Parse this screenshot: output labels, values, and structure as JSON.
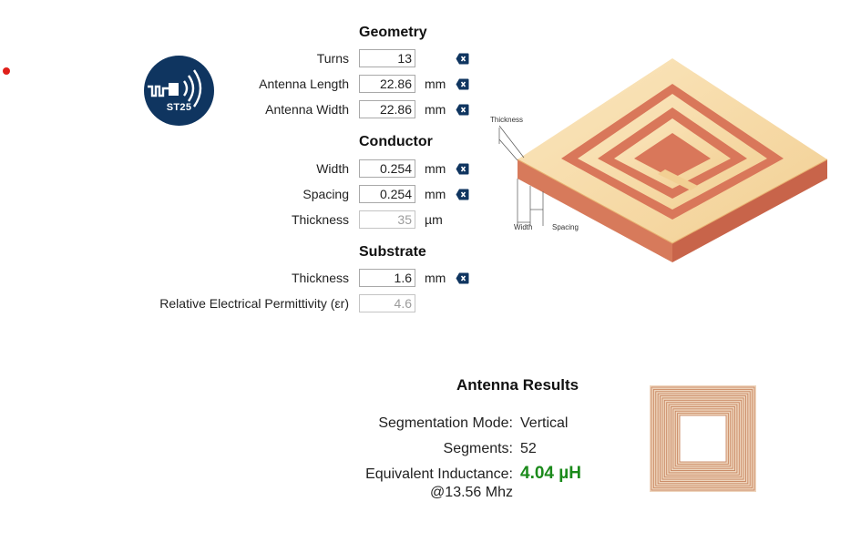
{
  "logo": {
    "text": "ST25"
  },
  "geometry": {
    "title": "Geometry",
    "turns": {
      "label": "Turns",
      "value": "13"
    },
    "length": {
      "label": "Antenna Length",
      "value": "22.86",
      "unit": "mm"
    },
    "width": {
      "label": "Antenna Width",
      "value": "22.86",
      "unit": "mm"
    }
  },
  "conductor": {
    "title": "Conductor",
    "width": {
      "label": "Width",
      "value": "0.254",
      "unit": "mm"
    },
    "spacing": {
      "label": "Spacing",
      "value": "0.254",
      "unit": "mm"
    },
    "thickness": {
      "label": "Thickness",
      "value": "35",
      "unit": "µm"
    }
  },
  "substrate": {
    "title": "Substrate",
    "thickness": {
      "label": "Thickness",
      "value": "1.6",
      "unit": "mm"
    },
    "permittivity": {
      "label": "Relative Electrical Permittivity (εr)",
      "value": "4.6"
    }
  },
  "diagram": {
    "thickness_label": "Thickness",
    "width_label": "Width",
    "spacing_label": "Spacing"
  },
  "results": {
    "title": "Antenna Results",
    "segmentation_label": "Segmentation Mode:",
    "segmentation_value": "Vertical",
    "segments_label": "Segments:",
    "segments_value": "52",
    "inductance_label": "Equivalent Inductance:",
    "inductance_value": "4.04 µH",
    "frequency_label": "@13.56 Mhz"
  },
  "colors": {
    "logo_bg": "#0f3560",
    "clear_button": "#0f3560",
    "result_value": "#1b8a1b",
    "copper": "#d9775a",
    "substrate_top": "#f8dca8"
  }
}
